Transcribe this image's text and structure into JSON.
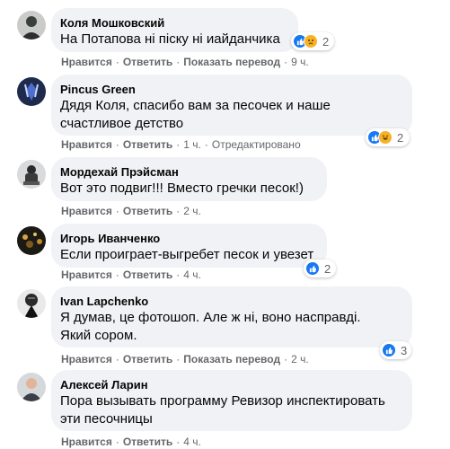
{
  "actions": {
    "like": "Нравится",
    "reply": "Ответить",
    "translate": "Показать перевод",
    "separator": "·"
  },
  "comments": [
    {
      "author": "Коля Мошковский",
      "lines": [
        "На Потапова ні піску ні иайданчика"
      ],
      "time": "9 ч.",
      "translate": true,
      "edited": "",
      "reactions": [
        "like-icon",
        "sad-icon"
      ],
      "reaction_count": "2"
    },
    {
      "author": "Pincus Green",
      "lines": [
        "Дядя Коля, спасибо вам за песочек и наше",
        "счастливое детство"
      ],
      "time": "1 ч.",
      "translate": false,
      "edited": "Отредактировано",
      "reactions": [
        "like-icon",
        "haha-icon"
      ],
      "reaction_count": "2"
    },
    {
      "author": "Мордехай Прэйсман",
      "lines": [
        "Вот это подвиг!!! Вместо гречки песок!)"
      ],
      "time": "2 ч.",
      "translate": false,
      "edited": "",
      "reactions": [],
      "reaction_count": ""
    },
    {
      "author": "Игорь Иванченко",
      "lines": [
        "Если проиграет-выгребет песок и увезет"
      ],
      "time": "4 ч.",
      "translate": false,
      "edited": "",
      "reactions": [
        "like-icon"
      ],
      "reaction_count": "2"
    },
    {
      "author": "Ivan Lapchenko",
      "lines": [
        "Я думав, це фотошоп. Але ж ні, воно насправді.",
        "Який сором."
      ],
      "time": "2 ч.",
      "translate": true,
      "edited": "",
      "reactions": [
        "like-icon"
      ],
      "reaction_count": "3"
    },
    {
      "author": "Алексей Ларин",
      "lines": [
        "Пора вызывать программу Ревизор инспектировать",
        "эти песочницы"
      ],
      "time": "4 ч.",
      "translate": false,
      "edited": "",
      "reactions": [],
      "reaction_count": ""
    }
  ],
  "colors": {
    "bubble": "#f0f2f5",
    "meta_text": "#65676b",
    "like_blue": "#1877f2",
    "emoji_yellow": "#f7b125"
  }
}
